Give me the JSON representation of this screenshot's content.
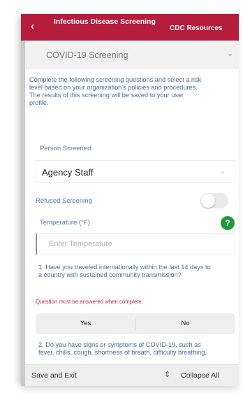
{
  "header": {
    "title": "Infectious Disease Screening",
    "link": "CDC Resources",
    "back_icon": "back-arrow-icon",
    "color": "#b61c3b"
  },
  "section": {
    "label": "COVID-19 Screening",
    "chevron_icon": "chevron-down-icon"
  },
  "intro": "Complete the following screening questions and select a risk level based on your organization's policies and procedures. The results of this screening will be saved to your user profile.",
  "person": {
    "label": "Person Screened",
    "value": "Agency Staff"
  },
  "refused": {
    "label": "Refused Screening",
    "enabled": false
  },
  "temperature": {
    "label": "Temperature (°F)",
    "placeholder": "Enter Temperature",
    "value": "",
    "help_icon": "help-icon"
  },
  "question1": {
    "text": "1. Have you traveled internationally within the last 14 days to a country with sustained community transmission?",
    "error": "Question must be answered when complete.",
    "options": [
      "Yes",
      "No"
    ],
    "error_color": "#c0284a"
  },
  "question2": {
    "text": "2. Do you have signs or symptoms of COVID-19, such as fever, chills, cough, shortness of breath, difficulty breathing,"
  },
  "footer": {
    "save_exit": "Save and Exit",
    "collapse_icon": "collapse-icon",
    "collapse_all": "Collapse All"
  },
  "colors": {
    "label_blue": "#4d7aa6",
    "toggle_green": "#1e9a3a"
  }
}
